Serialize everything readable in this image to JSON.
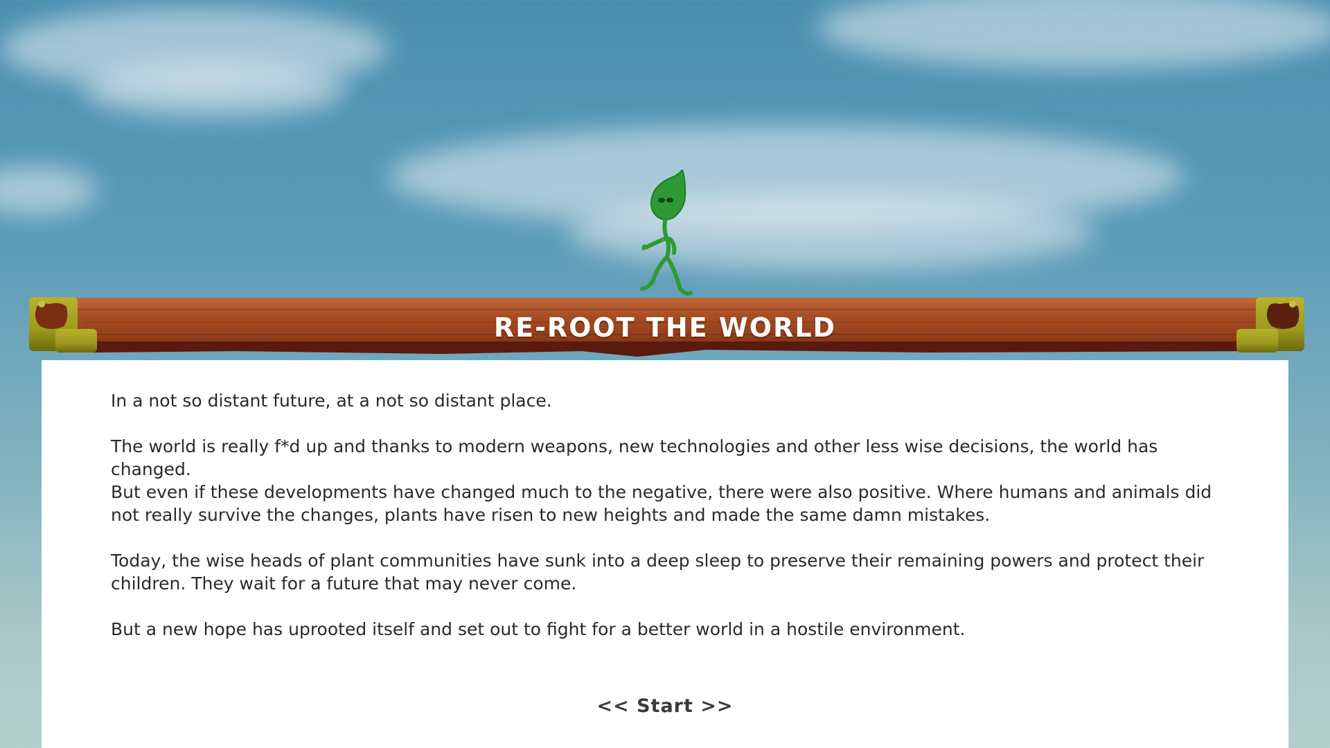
{
  "game": {
    "title": "RE-ROOT THE WORLD",
    "story_paragraphs": [
      "In a not so distant future, at a not so distant place.",
      "The world is really f*d up and thanks to modern weapons, new technologies and other less wise decisions, the world has changed.\nBut even if these developments have changed much to the negative, there were also positive. Where humans and animals did not really survive the changes, plants have risen to new heights and made the same damn mistakes.",
      "Today, the wise heads of plant communities have sunk into a deep sleep to preserve their remaining powers and protect their children. They wait for a future that may never come.",
      "But a new hope has uprooted itself and set out to fight for a better world in a hostile environment."
    ],
    "start_label": "<< Start >>"
  },
  "colors": {
    "sky_top": "#4a8fb0",
    "sky_bottom": "#b3d0cb",
    "banner_wood": "#a84e25",
    "banner_dark": "#5a1a0d",
    "corner_gold": "#9c9a1e",
    "mascot_green": "#2f9a35",
    "text": "#2a2a2a"
  },
  "icons": {
    "mascot": "leaf-sprout-character-icon",
    "corners": "wood-plank-corner-icon"
  }
}
